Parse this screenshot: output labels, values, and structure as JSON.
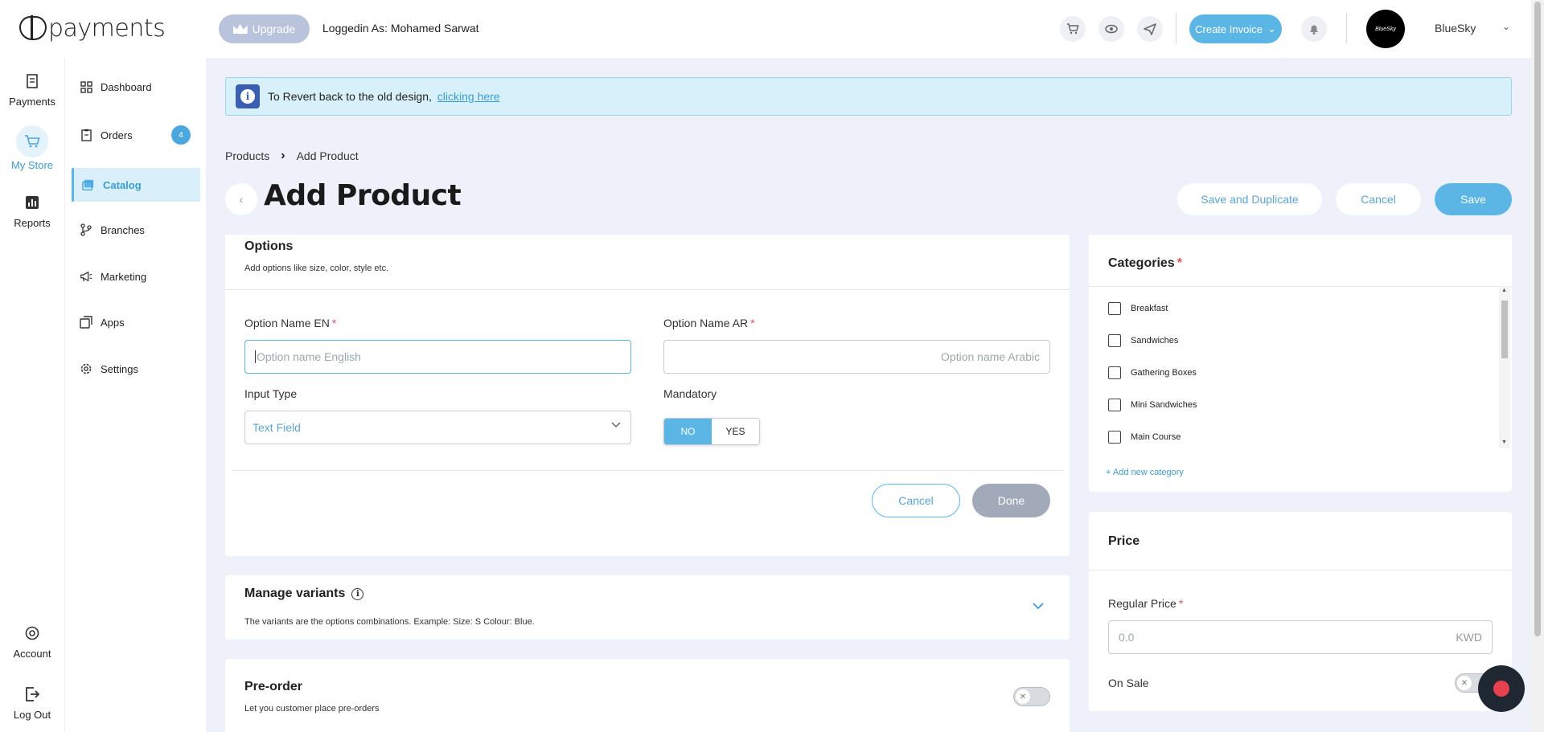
{
  "header": {
    "logo_text": "payments",
    "upgrade_label": "Upgrade",
    "logged_in_text": "Loggedin As: Mohamed Sarwat",
    "create_invoice_label": "Create Invoice",
    "avatar_text": "BlueSky",
    "brand_name": "BlueSky"
  },
  "rail": {
    "items": [
      {
        "label": "Payments",
        "icon": "receipt-icon"
      },
      {
        "label": "My Store",
        "icon": "cart-icon"
      },
      {
        "label": "Reports",
        "icon": "chart-icon"
      },
      {
        "label": "Account",
        "icon": "account-icon"
      },
      {
        "label": "Log Out",
        "icon": "logout-icon"
      }
    ]
  },
  "sidebar": {
    "items": [
      {
        "label": "Dashboard",
        "icon": "dashboard-icon"
      },
      {
        "label": "Orders",
        "icon": "orders-icon",
        "badge": "4"
      },
      {
        "label": "Catalog",
        "icon": "catalog-icon",
        "active": true
      },
      {
        "label": "Branches",
        "icon": "branches-icon"
      },
      {
        "label": "Marketing",
        "icon": "megaphone-icon"
      },
      {
        "label": "Apps",
        "icon": "apps-icon"
      },
      {
        "label": "Settings",
        "icon": "gear-icon"
      }
    ]
  },
  "banner": {
    "text": "To Revert back to the old design,",
    "link": "clicking here"
  },
  "breadcrumb": {
    "parent": "Products",
    "current": "Add Product"
  },
  "page": {
    "title": "Add Product",
    "save_duplicate_label": "Save and Duplicate",
    "cancel_label": "Cancel",
    "save_label": "Save"
  },
  "options": {
    "title": "Options",
    "subtitle": "Add options like size, color, style etc.",
    "name_en_label": "Option Name EN",
    "name_en_placeholder": "Option name English",
    "name_ar_label": "Option Name AR",
    "name_ar_placeholder": "Option name Arabic",
    "input_type_label": "Input Type",
    "input_type_value": "Text Field",
    "mandatory_label": "Mandatory",
    "mandatory_no": "NO",
    "mandatory_yes": "YES",
    "mandatory_value": "NO",
    "cancel_label": "Cancel",
    "done_label": "Done",
    "required_mark": "*"
  },
  "variants": {
    "title": "Manage variants",
    "subtitle": "The variants are the options combinations. Example: Size: S Colour: Blue."
  },
  "preorder": {
    "title": "Pre-order",
    "subtitle": "Let you customer place pre-orders",
    "enabled": false
  },
  "categories": {
    "title": "Categories",
    "items": [
      "Breakfast",
      "Sandwiches",
      "Gathering Boxes",
      "Mini Sandwiches",
      "Main Course"
    ],
    "add_label": "+ Add new category"
  },
  "price": {
    "title": "Price",
    "regular_label": "Regular Price",
    "regular_placeholder": "0.0",
    "currency": "KWD",
    "on_sale_label": "On Sale",
    "on_sale_enabled": false
  },
  "colors": {
    "accent": "#5bb6e6",
    "active_text": "#3a9ed6",
    "banner_bg": "#d8f0fa",
    "required": "#e05353"
  }
}
